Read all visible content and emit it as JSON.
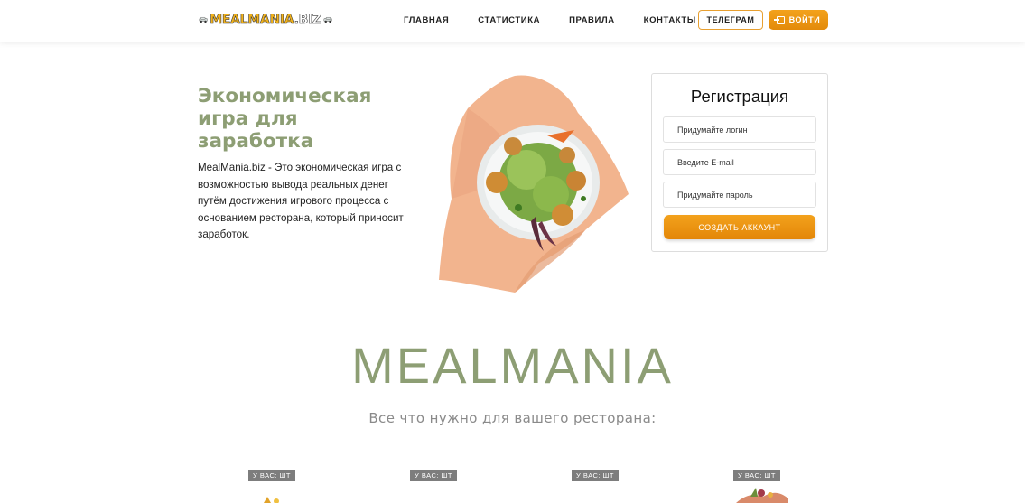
{
  "header": {
    "logo": {
      "main": "MEALMANIA",
      "suffix": ".BIZ"
    },
    "nav": [
      "ГЛАВНАЯ",
      "СТАТИСТИКА",
      "ПРАВИЛА",
      "КОНТАКТЫ"
    ],
    "telegram_label": "ТЕЛЕГРАМ",
    "login_label": "ВОЙТИ"
  },
  "hero": {
    "title": "Экономическая игра для заработка",
    "description": "MealMania.biz - Это экономическая игра с возможностью вывода реальных денег путём достижения игрового процесса с основанием ресторана, который приносит заработок."
  },
  "registration": {
    "title": "Регистрация",
    "login_placeholder": "Придумайте логин",
    "email_placeholder": "Введите E-mail",
    "password_placeholder": "Придумайте пароль",
    "submit_label": "СОЗДАТЬ АККАУНТ"
  },
  "brand": {
    "title": "MEALMANIA",
    "subtitle": "Все что нужно для вашего ресторана:"
  },
  "items": [
    {
      "badge": "У ВАС: ШТ"
    },
    {
      "badge": "У ВАС: ШТ"
    },
    {
      "badge": "У ВАС: ШТ"
    },
    {
      "badge": "У ВАС: ШТ"
    }
  ],
  "colors": {
    "accent_orange": "#ef9a16",
    "brand_green": "#8d9e74",
    "badge_gray": "#7d7d7d"
  },
  "icons": [
    "login-icon",
    "car-icon"
  ]
}
